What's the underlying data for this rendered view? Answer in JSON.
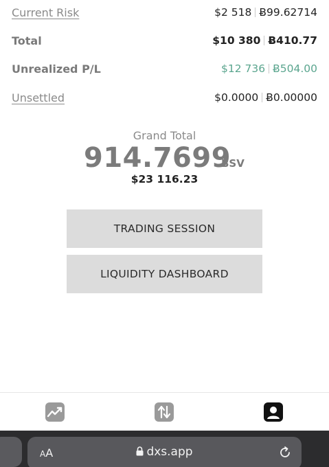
{
  "rows": [
    {
      "label": "Current Risk",
      "usd": "$2 518",
      "bsv": "Ƀ99.62714"
    },
    {
      "label": "Total",
      "usd": "$10 380",
      "bsv": "Ƀ410.77"
    },
    {
      "label": "Unrealized P/L",
      "usd": "$12 736",
      "bsv": "Ƀ504.00"
    },
    {
      "label": "Unsettled",
      "usd": "$0.0000",
      "bsv": "Ƀ0.00000"
    }
  ],
  "grand_total": {
    "label": "Grand Total",
    "value": "914.7699",
    "unit": "BSV",
    "usd": "$23 116.23"
  },
  "buttons": {
    "trading_session": "TRADING SESSION",
    "liquidity_dashboard": "LIQUIDITY DASHBOARD"
  },
  "tabs": [
    {
      "icon": "chart-icon"
    },
    {
      "icon": "transfer-icon"
    },
    {
      "icon": "profile-icon"
    }
  ],
  "browser": {
    "aa_small": "A",
    "aa_large": "A",
    "url": "dxs.app"
  },
  "colors": {
    "green": "#5aa58e",
    "button_bg": "#dcdcdc",
    "safari_bg": "#2c2c2e"
  }
}
